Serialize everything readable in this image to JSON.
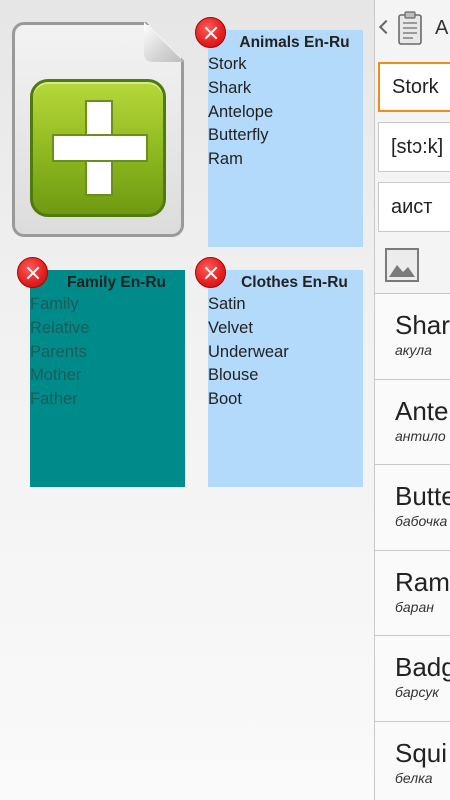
{
  "add_deck": {
    "icon": "add-document-icon"
  },
  "decks": [
    {
      "title": "Animals En-Ru",
      "words": [
        "Stork",
        "Shark",
        "Antelope",
        "Butterfly",
        "Ram"
      ],
      "color": "#b3dafa"
    },
    {
      "title": "Family En-Ru",
      "words": [
        "Family",
        "Relative",
        "Parents",
        "Mother",
        "Father"
      ],
      "color": "#008b8b"
    },
    {
      "title": "Clothes En-Ru",
      "words": [
        "Satin",
        "Velvet",
        "Underwear",
        "Blouse",
        "Boot"
      ],
      "color": "#b3dafa"
    }
  ],
  "drawer": {
    "title": "A",
    "word_value": "Stork",
    "transcription_value": "[stɔ:k]",
    "translation_value": "аист",
    "list": [
      {
        "word": "Shar",
        "translation": "акула"
      },
      {
        "word": "Ante",
        "translation": "антило"
      },
      {
        "word": "Butte",
        "translation": "бабочка"
      },
      {
        "word": "Ram",
        "translation": "баран"
      },
      {
        "word": "Badg",
        "translation": "барсук"
      },
      {
        "word": "Squi",
        "translation": "белка"
      }
    ]
  },
  "colors": {
    "accent_focus": "#f08c1a",
    "delete_red": "#e11f1f",
    "deck_light": "#b3dafa",
    "deck_teal": "#008b8b"
  }
}
